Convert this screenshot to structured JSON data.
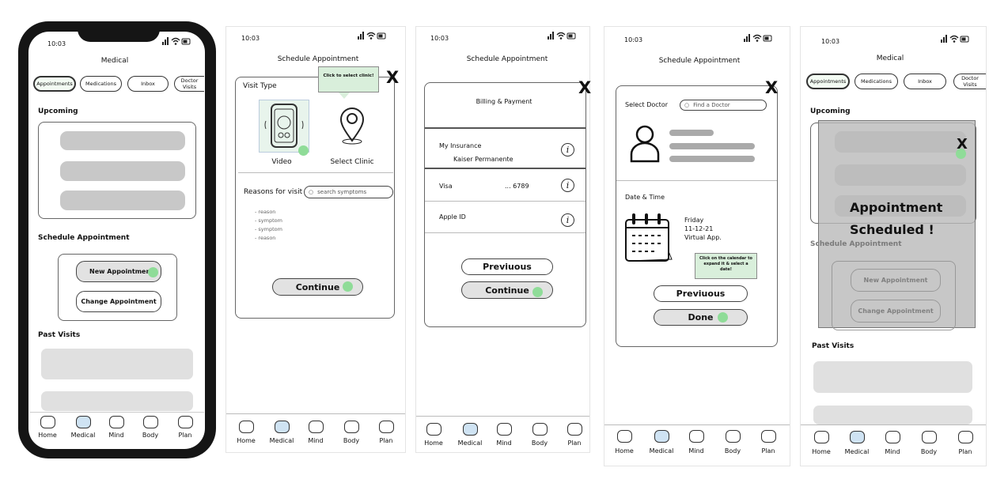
{
  "time": "10:03",
  "nav": [
    "Home",
    "Medical",
    "Mind",
    "Body",
    "Plan"
  ],
  "nav_selected": "Medical",
  "accent": "#8fdc98",
  "screen1": {
    "title": "Medical",
    "tabs": [
      "Appointments",
      "Medications",
      "Inbox",
      "Doctor Visits"
    ],
    "upcoming": "Upcoming",
    "schedule": "Schedule Appointment",
    "new_appt": "New Appointment",
    "change_appt": "Change Appointment",
    "past": "Past Visits"
  },
  "screen2": {
    "title": "Schedule Appointment",
    "visit_type": "Visit Type",
    "tooltip": "Click to select clinic!",
    "video": "Video",
    "clinic": "Select Clinic",
    "reasons": "Reasons for visit",
    "search_placeholder": "search symptoms",
    "list": [
      "reason",
      "symptom",
      "symptom",
      "reason"
    ],
    "continue": "Continue"
  },
  "screen3": {
    "title": "Schedule Appointment",
    "header": "Billing & Payment",
    "insurance": "My Insurance",
    "insurer": "Kaiser Permanente",
    "visa": "Visa",
    "visa_num": "... 6789",
    "apple": "Apple ID",
    "previous": "Previuous",
    "continue": "Continue"
  },
  "screen4": {
    "title": "Schedule Appointment",
    "select_doctor": "Select Doctor",
    "search_placeholder": "Find a Doctor",
    "date_time": "Date & Time",
    "day": "Friday",
    "date": "11-12-21",
    "type": "Virtual App.",
    "tooltip": "Click on the calendar to expand it & select a date!",
    "previous": "Previuous",
    "done": "Done"
  },
  "screen5": {
    "title": "Medical",
    "tabs": [
      "Appointments",
      "Medications",
      "Inbox",
      "Doctor Visits"
    ],
    "upcoming": "Upcoming",
    "message_line1": "Appointment",
    "message_line2": "Scheduled !",
    "schedule": "Schedule Appointment",
    "new_appt": "New Appointment",
    "change_appt": "Change Appointment",
    "past": "Past Visits"
  }
}
